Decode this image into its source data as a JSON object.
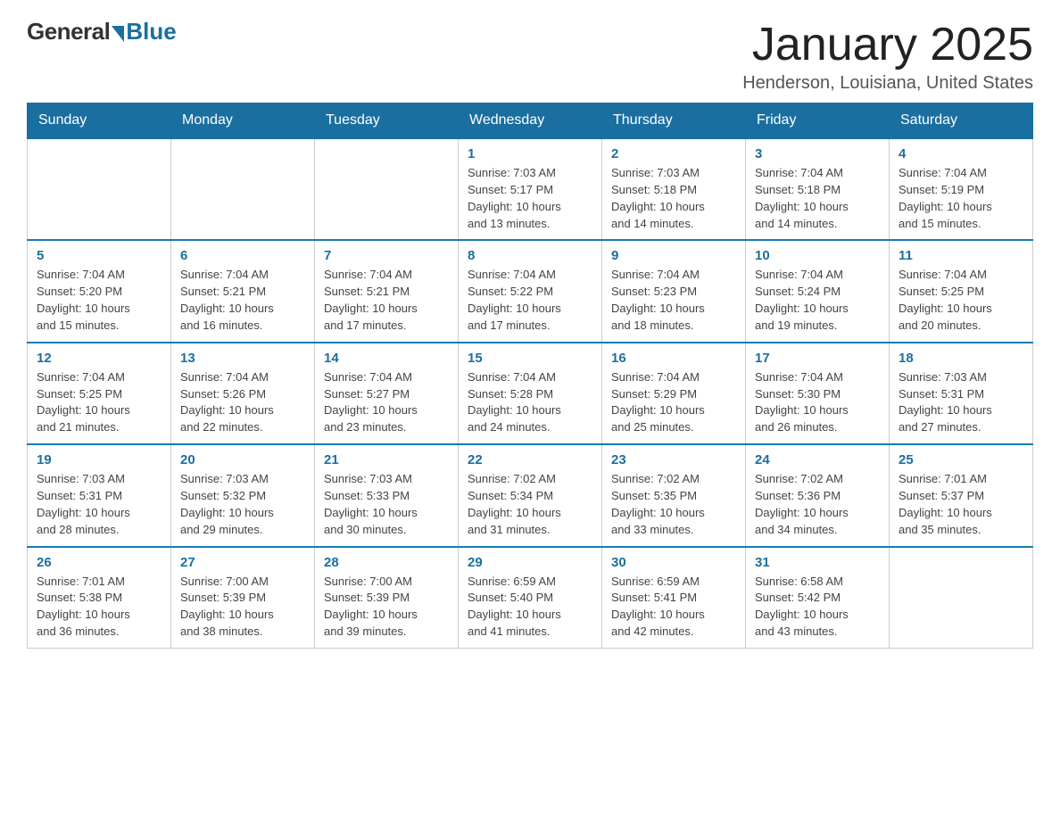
{
  "logo": {
    "general": "General",
    "blue": "Blue",
    "subtitle": ""
  },
  "title": {
    "month": "January 2025",
    "location": "Henderson, Louisiana, United States"
  },
  "weekdays": [
    "Sunday",
    "Monday",
    "Tuesday",
    "Wednesday",
    "Thursday",
    "Friday",
    "Saturday"
  ],
  "weeks": [
    [
      {
        "day": "",
        "info": ""
      },
      {
        "day": "",
        "info": ""
      },
      {
        "day": "",
        "info": ""
      },
      {
        "day": "1",
        "info": "Sunrise: 7:03 AM\nSunset: 5:17 PM\nDaylight: 10 hours\nand 13 minutes."
      },
      {
        "day": "2",
        "info": "Sunrise: 7:03 AM\nSunset: 5:18 PM\nDaylight: 10 hours\nand 14 minutes."
      },
      {
        "day": "3",
        "info": "Sunrise: 7:04 AM\nSunset: 5:18 PM\nDaylight: 10 hours\nand 14 minutes."
      },
      {
        "day": "4",
        "info": "Sunrise: 7:04 AM\nSunset: 5:19 PM\nDaylight: 10 hours\nand 15 minutes."
      }
    ],
    [
      {
        "day": "5",
        "info": "Sunrise: 7:04 AM\nSunset: 5:20 PM\nDaylight: 10 hours\nand 15 minutes."
      },
      {
        "day": "6",
        "info": "Sunrise: 7:04 AM\nSunset: 5:21 PM\nDaylight: 10 hours\nand 16 minutes."
      },
      {
        "day": "7",
        "info": "Sunrise: 7:04 AM\nSunset: 5:21 PM\nDaylight: 10 hours\nand 17 minutes."
      },
      {
        "day": "8",
        "info": "Sunrise: 7:04 AM\nSunset: 5:22 PM\nDaylight: 10 hours\nand 17 minutes."
      },
      {
        "day": "9",
        "info": "Sunrise: 7:04 AM\nSunset: 5:23 PM\nDaylight: 10 hours\nand 18 minutes."
      },
      {
        "day": "10",
        "info": "Sunrise: 7:04 AM\nSunset: 5:24 PM\nDaylight: 10 hours\nand 19 minutes."
      },
      {
        "day": "11",
        "info": "Sunrise: 7:04 AM\nSunset: 5:25 PM\nDaylight: 10 hours\nand 20 minutes."
      }
    ],
    [
      {
        "day": "12",
        "info": "Sunrise: 7:04 AM\nSunset: 5:25 PM\nDaylight: 10 hours\nand 21 minutes."
      },
      {
        "day": "13",
        "info": "Sunrise: 7:04 AM\nSunset: 5:26 PM\nDaylight: 10 hours\nand 22 minutes."
      },
      {
        "day": "14",
        "info": "Sunrise: 7:04 AM\nSunset: 5:27 PM\nDaylight: 10 hours\nand 23 minutes."
      },
      {
        "day": "15",
        "info": "Sunrise: 7:04 AM\nSunset: 5:28 PM\nDaylight: 10 hours\nand 24 minutes."
      },
      {
        "day": "16",
        "info": "Sunrise: 7:04 AM\nSunset: 5:29 PM\nDaylight: 10 hours\nand 25 minutes."
      },
      {
        "day": "17",
        "info": "Sunrise: 7:04 AM\nSunset: 5:30 PM\nDaylight: 10 hours\nand 26 minutes."
      },
      {
        "day": "18",
        "info": "Sunrise: 7:03 AM\nSunset: 5:31 PM\nDaylight: 10 hours\nand 27 minutes."
      }
    ],
    [
      {
        "day": "19",
        "info": "Sunrise: 7:03 AM\nSunset: 5:31 PM\nDaylight: 10 hours\nand 28 minutes."
      },
      {
        "day": "20",
        "info": "Sunrise: 7:03 AM\nSunset: 5:32 PM\nDaylight: 10 hours\nand 29 minutes."
      },
      {
        "day": "21",
        "info": "Sunrise: 7:03 AM\nSunset: 5:33 PM\nDaylight: 10 hours\nand 30 minutes."
      },
      {
        "day": "22",
        "info": "Sunrise: 7:02 AM\nSunset: 5:34 PM\nDaylight: 10 hours\nand 31 minutes."
      },
      {
        "day": "23",
        "info": "Sunrise: 7:02 AM\nSunset: 5:35 PM\nDaylight: 10 hours\nand 33 minutes."
      },
      {
        "day": "24",
        "info": "Sunrise: 7:02 AM\nSunset: 5:36 PM\nDaylight: 10 hours\nand 34 minutes."
      },
      {
        "day": "25",
        "info": "Sunrise: 7:01 AM\nSunset: 5:37 PM\nDaylight: 10 hours\nand 35 minutes."
      }
    ],
    [
      {
        "day": "26",
        "info": "Sunrise: 7:01 AM\nSunset: 5:38 PM\nDaylight: 10 hours\nand 36 minutes."
      },
      {
        "day": "27",
        "info": "Sunrise: 7:00 AM\nSunset: 5:39 PM\nDaylight: 10 hours\nand 38 minutes."
      },
      {
        "day": "28",
        "info": "Sunrise: 7:00 AM\nSunset: 5:39 PM\nDaylight: 10 hours\nand 39 minutes."
      },
      {
        "day": "29",
        "info": "Sunrise: 6:59 AM\nSunset: 5:40 PM\nDaylight: 10 hours\nand 41 minutes."
      },
      {
        "day": "30",
        "info": "Sunrise: 6:59 AM\nSunset: 5:41 PM\nDaylight: 10 hours\nand 42 minutes."
      },
      {
        "day": "31",
        "info": "Sunrise: 6:58 AM\nSunset: 5:42 PM\nDaylight: 10 hours\nand 43 minutes."
      },
      {
        "day": "",
        "info": ""
      }
    ]
  ]
}
